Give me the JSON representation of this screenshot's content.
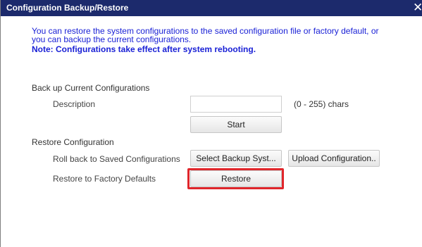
{
  "dialog": {
    "title": "Configuration Backup/Restore",
    "close_glyph": "✕",
    "intro_line1": "You can restore the system configurations to the saved configuration file or factory default, or",
    "intro_line2": "you can backup the current configurations.",
    "note": "Note: Configurations take effect after system rebooting."
  },
  "backup": {
    "section_title": "Back up Current Configurations",
    "description_label": "Description",
    "description_value": "",
    "description_hint": "(0 - 255) chars",
    "start_button": "Start"
  },
  "restore": {
    "section_title": "Restore Configuration",
    "rollback_label": "Roll back to Saved Configurations",
    "select_backup_button": "Select Backup Syst...",
    "upload_button": "Upload Configuration..",
    "factory_label": "Restore to Factory Defaults",
    "restore_button": "Restore"
  },
  "colors": {
    "titlebar": "#1c2a6c",
    "info_text": "#1a21d6",
    "highlight": "#e0262b"
  }
}
